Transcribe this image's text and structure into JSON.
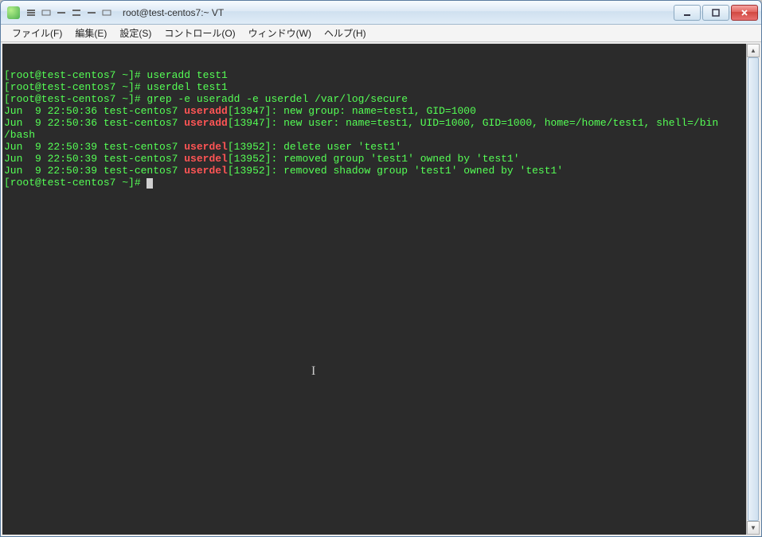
{
  "window": {
    "title": "root@test-centos7:~ VT"
  },
  "menu": {
    "file": "ファイル(F)",
    "edit": "編集(E)",
    "settings": "設定(S)",
    "control": "コントロール(O)",
    "window": "ウィンドウ(W)",
    "help": "ヘルプ(H)"
  },
  "terminal": {
    "lines": [
      {
        "pre": "[root@test-centos7 ~]# useradd test1",
        "hl": "",
        "post": ""
      },
      {
        "pre": "[root@test-centos7 ~]# userdel test1",
        "hl": "",
        "post": ""
      },
      {
        "pre": "[root@test-centos7 ~]# grep -e useradd -e userdel /var/log/secure",
        "hl": "",
        "post": ""
      },
      {
        "pre": "Jun  9 22:50:36 test-centos7 ",
        "hl": "useradd",
        "post": "[13947]: new group: name=test1, GID=1000"
      },
      {
        "pre": "Jun  9 22:50:36 test-centos7 ",
        "hl": "useradd",
        "post": "[13947]: new user: name=test1, UID=1000, GID=1000, home=/home/test1, shell=/bin"
      },
      {
        "pre": "/bash",
        "hl": "",
        "post": ""
      },
      {
        "pre": "Jun  9 22:50:39 test-centos7 ",
        "hl": "userdel",
        "post": "[13952]: delete user 'test1'"
      },
      {
        "pre": "Jun  9 22:50:39 test-centos7 ",
        "hl": "userdel",
        "post": "[13952]: removed group 'test1' owned by 'test1'"
      },
      {
        "pre": "Jun  9 22:50:39 test-centos7 ",
        "hl": "userdel",
        "post": "[13952]: removed shadow group 'test1' owned by 'test1'"
      }
    ],
    "prompt": "[root@test-centos7 ~]# "
  }
}
